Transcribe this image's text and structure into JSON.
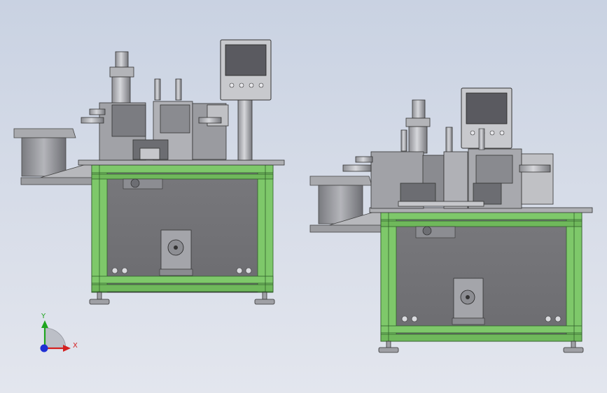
{
  "triad": {
    "x_label": "X",
    "y_label": "Y",
    "x_color": "#d42020",
    "y_color": "#1fa51f",
    "z_color": "#1f2fd4"
  },
  "colors": {
    "frame_green": "#7ec86a",
    "frame_green_dark": "#3f7a36",
    "panel_grey": "#7e7e82",
    "steel_light": "#c7c8cc",
    "steel_mid": "#a3a4a9",
    "steel_dark": "#5c5d61",
    "screen": "#5a5a60"
  }
}
